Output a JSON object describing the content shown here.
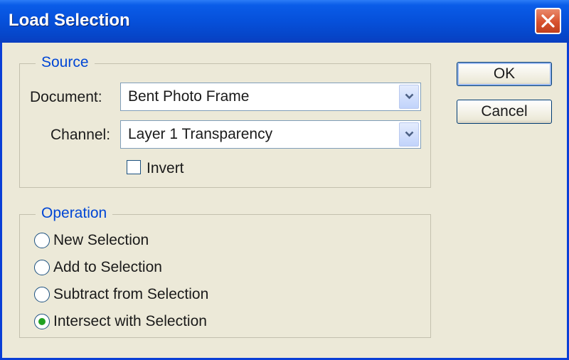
{
  "window": {
    "title": "Load Selection"
  },
  "source": {
    "legend": "Source",
    "document_label": "Document:",
    "document_value": "Bent Photo Frame",
    "channel_label": "Channel:",
    "channel_value": "Layer 1 Transparency",
    "invert_label": "Invert",
    "invert_checked": false
  },
  "operation": {
    "legend": "Operation",
    "options": [
      {
        "label": "New Selection",
        "selected": false
      },
      {
        "label": "Add to Selection",
        "selected": false
      },
      {
        "label": "Subtract from Selection",
        "selected": false
      },
      {
        "label": "Intersect with Selection",
        "selected": true
      }
    ]
  },
  "buttons": {
    "ok": "OK",
    "cancel": "Cancel"
  },
  "icons": {
    "close": "close-icon",
    "dropdown": "chevron-down-icon"
  },
  "colors": {
    "title_bar": "#0650da",
    "accent": "#0046d5",
    "radio_selected": "#21a121",
    "close_button": "#d8522e"
  }
}
